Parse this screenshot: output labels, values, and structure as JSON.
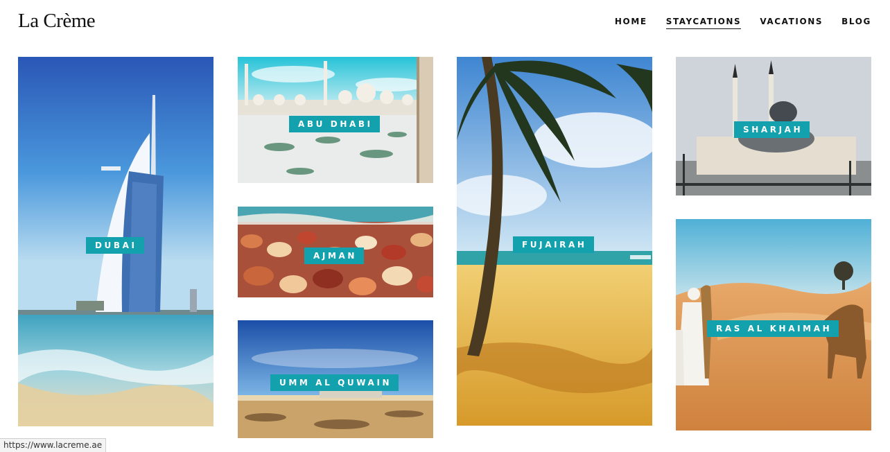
{
  "site": {
    "logo": "La Crème"
  },
  "nav": {
    "items": [
      {
        "label": "HOME",
        "active": false
      },
      {
        "label": "STAYCATIONS",
        "active": true
      },
      {
        "label": "VACATIONS",
        "active": false
      },
      {
        "label": "BLOG",
        "active": false
      }
    ]
  },
  "destinations": [
    {
      "name": "DUBAI"
    },
    {
      "name": "ABU DHABI"
    },
    {
      "name": "AJMAN"
    },
    {
      "name": "UMM AL QUWAIN"
    },
    {
      "name": "FUJAIRAH"
    },
    {
      "name": "SHARJAH"
    },
    {
      "name": "RAS AL KHAIMAH"
    }
  ],
  "status": {
    "url": "https://www.lacreme.ae"
  },
  "colors": {
    "label_bg": "#12a1ad",
    "label_text": "#ffffff",
    "text": "#111111"
  }
}
